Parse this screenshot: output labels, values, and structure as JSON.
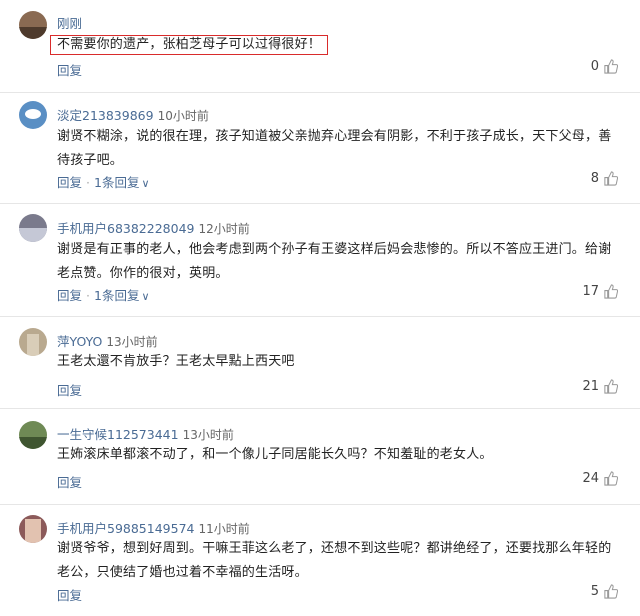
{
  "comments": [
    {
      "user": "刚刚",
      "time": "",
      "text": "不需要你的遗产，张柏芝母子可以过得很好！",
      "reply": "回复",
      "replies": "",
      "likes": "0",
      "avatar_color": "#8a6a52"
    },
    {
      "user": "淡定213839869",
      "time": "10小时前",
      "text": "谢贤不糊涂，说的很在理，孩子知道被父亲抛弃心理会有阴影，不利于孩子成长，天下父母，善待孩子吧。",
      "reply": "回复",
      "replies": "1条回复",
      "likes": "8",
      "avatar_color": "#5a8fc4"
    },
    {
      "user": "手机用户68382228049",
      "time": "12小时前",
      "text": "谢贤是有正事的老人，他会考虑到两个孙子有王婆这样后妈会悲惨的。所以不答应王进门。给谢老点赞。你作的很对，英明。",
      "reply": "回复",
      "replies": "1条回复",
      "likes": "17",
      "avatar_color": "#7a7a8c"
    },
    {
      "user": "萍YOYO",
      "time": "13小时前",
      "text": "王老太還不肯放手？王老太早點上西天吧",
      "reply": "回复",
      "replies": "",
      "likes": "21",
      "avatar_color": "#b9a98f"
    },
    {
      "user": "一生守候112573441",
      "time": "13小时前",
      "text": "王㚴滚床单都滚不动了，和一个像儿子同居能长久吗？不知羞耻的老女人。",
      "reply": "回复",
      "replies": "",
      "likes": "24",
      "avatar_color": "#6f8a55"
    },
    {
      "user": "手机用户59885149574",
      "time": "11小时前",
      "text": "谢贤爷爷，想到好周到。干嘛王菲这么老了，还想不到这些呢？都讲绝经了，还要找那么年轻的老公，只使结了婚也过着不幸福的生活呀。",
      "reply": "回复",
      "replies": "",
      "likes": "5",
      "avatar_color": "#8c5a5a"
    }
  ],
  "colors": {
    "link": "#4a6b94",
    "highlight_border": "#d92b2b"
  },
  "icons": {
    "like": "thumb-up-icon",
    "expand": "chevron-down-icon"
  }
}
